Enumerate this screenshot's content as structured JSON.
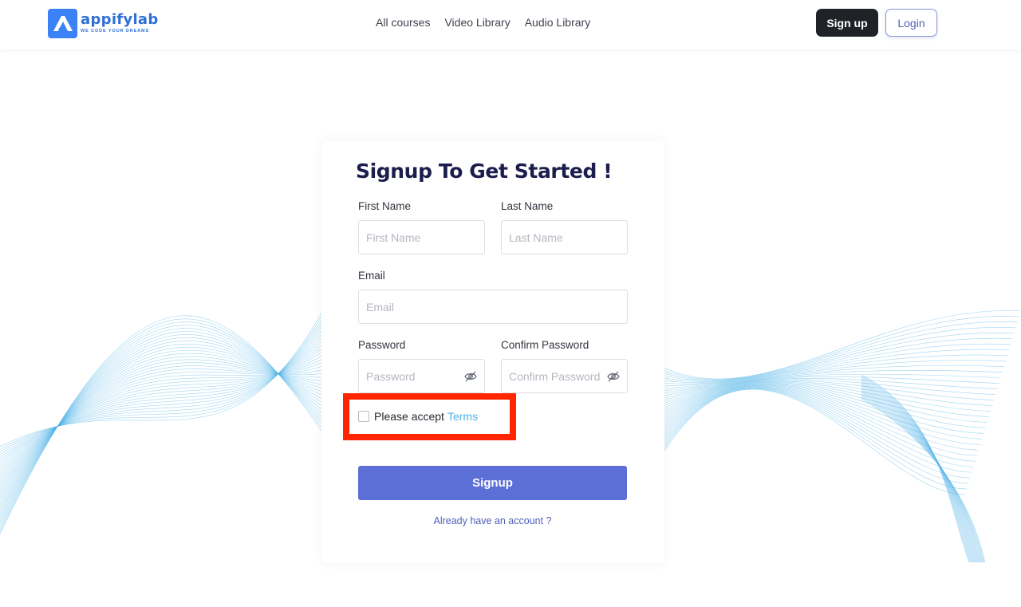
{
  "brand": {
    "name": "appifylab",
    "tagline": "WE CODE YOUR DREAMS",
    "color": "#2f6fd6"
  },
  "nav": {
    "items": [
      {
        "label": "All courses"
      },
      {
        "label": "Video Library"
      },
      {
        "label": "Audio Library"
      }
    ]
  },
  "header_buttons": {
    "signup_label": "Sign up",
    "login_label": "Login"
  },
  "form": {
    "title": "Signup To Get Started !",
    "first_name": {
      "label": "First Name",
      "placeholder": "First Name",
      "value": ""
    },
    "last_name": {
      "label": "Last Name",
      "placeholder": "Last Name",
      "value": ""
    },
    "email": {
      "label": "Email",
      "placeholder": "Email",
      "value": ""
    },
    "password": {
      "label": "Password",
      "placeholder": "Password",
      "value": "",
      "icon": "eye-off-icon"
    },
    "confirm_password": {
      "label": "Confirm Password",
      "placeholder": "Confirm Password",
      "value": "",
      "icon": "eye-off-icon"
    },
    "terms": {
      "prefix": "Please accept",
      "link": "Terms",
      "checked": false
    },
    "submit_label": "Signup",
    "login_link": "Already have an account ?"
  },
  "colors": {
    "primary_button": "#5c6fd6",
    "dark_button": "#1f2328",
    "link": "#4fb2e8",
    "highlight": "#ff2600",
    "wave": "#4fb2e8"
  }
}
